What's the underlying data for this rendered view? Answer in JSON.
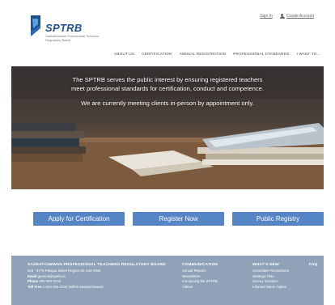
{
  "header": {
    "sign_in": "Sign In",
    "create_account": "Create Account",
    "logo_name": "SPTRB",
    "logo_subtitle": "Saskatchewan Professional Teachers Regulatory Board"
  },
  "nav": {
    "items": [
      "ABOUT US",
      "CERTIFICATION",
      "ANNUAL REGISTRATION",
      "PROFESSIONAL STANDARDS",
      "I WANT TO..."
    ]
  },
  "hero": {
    "line1": "The SPTRB serves the public interest by ensuring registered teachers meet professional standards for certification, conduct and competence.",
    "line2": "We are currently meeting clients in-person by appointment only."
  },
  "buttons": {
    "apply": "Apply for Certification",
    "register": "Register Now",
    "registry": "Public Registry"
  },
  "footer": {
    "org_title": "SASKATCHEWAN PROFESSIONAL TEACHERS REGULATORY BOARD",
    "address": "204 - 3775 Pasqua Street Regina SK S4S 6W8",
    "email_label": "Email",
    "email": "general@sptrb.ca",
    "phone_label": "Phone",
    "phone": "306-352-2230",
    "tollfree_label": "Toll Free",
    "tollfree": "1-844-254-2230 (within Saskatchewan)",
    "communication_title": "COMMUNICATION",
    "communication_items": [
      "Annual Reports",
      "Newsletters",
      "Introducing the SPTRB",
      "Videos"
    ],
    "whats_new_title": "WHAT'S NEW",
    "whats_new_items": [
      "Committee Recruitment",
      "Strategic Plan",
      "Survey Invitation",
      "Informal Name Option"
    ],
    "faq_title": "FAQ"
  },
  "colors": {
    "brand_blue": "#1f4f8f",
    "button_blue": "#5585c5",
    "footer_bg": "#8fa2b8"
  }
}
